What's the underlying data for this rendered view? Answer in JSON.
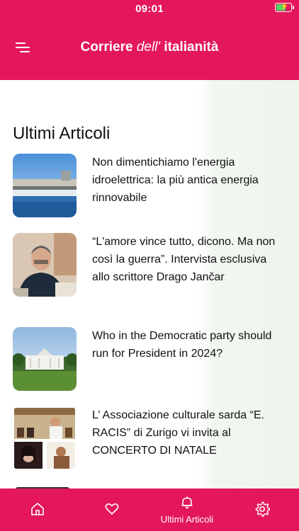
{
  "status_bar": {
    "time": "09:01"
  },
  "header": {
    "brand_part1": "Corriere",
    "brand_part2": "dell'",
    "brand_part3": "italianità"
  },
  "main": {
    "section_title": "Ultimi Articoli",
    "articles": [
      {
        "title": "Non dimentichiamo l'energia idroelettrica: la più antica energia rinnovabile",
        "image": "hydroelectric-dam"
      },
      {
        "title": "“L'amore vince tutto, dicono. Ma non così la guerra”. Intervista esclusiva allo scrittore Drago Jančar",
        "image": "writer-portrait"
      },
      {
        "title": "Who in the Democratic party should run for President in 2024?",
        "image": "white-house"
      },
      {
        "title": "L’ Associazione culturale sarda “E. RACIS” di Zurigo vi invita al CONCERTO DI NATALE",
        "image": "concert-collage"
      }
    ]
  },
  "tabbar": {
    "active_label": "Ultimi Articoli",
    "tabs": [
      "home-icon",
      "heart-icon",
      "bell-icon",
      "gear-icon"
    ]
  },
  "colors": {
    "accent": "#e3175a",
    "battery": "#4cd964"
  }
}
